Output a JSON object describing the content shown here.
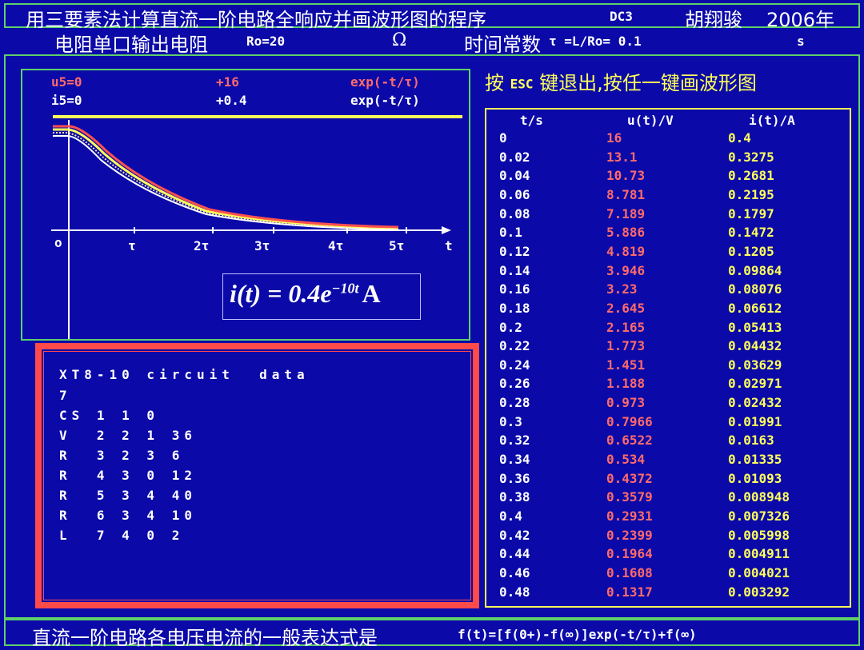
{
  "header": {
    "title": "用三要素法计算直流一阶电路全响应并画波形图的程序",
    "program_code": "DC3",
    "author": "胡翔骏",
    "year": "2006年"
  },
  "params": {
    "label_resistance": "电阻单口输出电阻",
    "ro_text": "Ro=20",
    "ohm_unit": "Ω",
    "label_time_constant": "时间常数",
    "tau_text": "τ =L/Ro= 0.1",
    "sec_unit": "s"
  },
  "prompt": {
    "before": "按",
    "key": "ESC",
    "after": "键退出,按任一键画波形图"
  },
  "graph": {
    "u_label": "u5=0",
    "u_amp": "+16",
    "u_exp": "exp(-t/τ)",
    "i_label": "i5=0",
    "i_amp": "+0.4",
    "i_exp": "exp(-t/τ)",
    "origin": "o",
    "ticks": [
      "τ",
      "2τ",
      "3τ",
      "4τ",
      "5τ"
    ],
    "t_axis": "t",
    "formula": {
      "lhs": "i(t) = 0.4e",
      "exponent": "−10t",
      "unit": "A"
    },
    "colors": {
      "yellow": "#ffff5a",
      "red": "#ff5050",
      "white": "#ffffff"
    }
  },
  "circuit": {
    "lines": [
      "XT8-10 circuit  data",
      "7",
      "CS 1 1 0",
      "V  2 2 1 36",
      "R  3 2 3 6",
      "R  4 3 0 12",
      "R  5 3 4 40",
      "R  6 3 4 10",
      "L  7 4 0 2"
    ]
  },
  "table": {
    "headers": [
      "t/s",
      "u(t)/V",
      "i(t)/A"
    ],
    "rows": [
      [
        "0",
        "16",
        "0.4"
      ],
      [
        "0.02",
        "13.1",
        "0.3275"
      ],
      [
        "0.04",
        "10.73",
        "0.2681"
      ],
      [
        "0.06",
        "8.781",
        "0.2195"
      ],
      [
        "0.08",
        "7.189",
        "0.1797"
      ],
      [
        "0.1",
        "5.886",
        "0.1472"
      ],
      [
        "0.12",
        "4.819",
        "0.1205"
      ],
      [
        "0.14",
        "3.946",
        "0.09864"
      ],
      [
        "0.16",
        "3.23",
        "0.08076"
      ],
      [
        "0.18",
        "2.645",
        "0.06612"
      ],
      [
        "0.2",
        "2.165",
        "0.05413"
      ],
      [
        "0.22",
        "1.773",
        "0.04432"
      ],
      [
        "0.24",
        "1.451",
        "0.03629"
      ],
      [
        "0.26",
        "1.188",
        "0.02971"
      ],
      [
        "0.28",
        "0.973",
        "0.02432"
      ],
      [
        "0.3",
        "0.7966",
        "0.01991"
      ],
      [
        "0.32",
        "0.6522",
        "0.0163"
      ],
      [
        "0.34",
        "0.534",
        "0.01335"
      ],
      [
        "0.36",
        "0.4372",
        "0.01093"
      ],
      [
        "0.38",
        "0.3579",
        "0.008948"
      ],
      [
        "0.4",
        "0.2931",
        "0.007326"
      ],
      [
        "0.42",
        "0.2399",
        "0.005998"
      ],
      [
        "0.44",
        "0.1964",
        "0.004911"
      ],
      [
        "0.46",
        "0.1608",
        "0.004021"
      ],
      [
        "0.48",
        "0.1317",
        "0.003292"
      ]
    ]
  },
  "footer": {
    "label": "直流一阶电路各电压电流的一般表达式是",
    "formula": "f(t)=[f(0+)-f(∞)]exp(-t/τ)+f(∞)"
  }
}
